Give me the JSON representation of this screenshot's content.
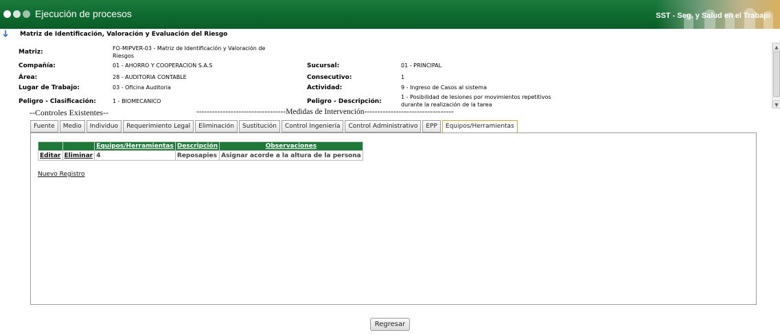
{
  "header": {
    "title": "Ejecución de procesos",
    "brand": "SST - Seg. y Salud en el Trabajo"
  },
  "section_title": "Matriz de Identificación, Valoración y Evaluación del Riesgo",
  "info": {
    "matriz_label": "Matriz:",
    "matriz_value": "FO-MIPVER-03 - Matriz de Identificación y Valoración de Riesgos",
    "compania_label": "Compañía:",
    "compania_value": "01 - AHORRO Y COOPERACION S.A.S",
    "sucursal_label": "Sucursal:",
    "sucursal_value": "01 - PRINCIPAL",
    "area_label": "Área:",
    "area_value": "28 - AUDITORIA CONTABLE",
    "consecutivo_label": "Consecutivo:",
    "consecutivo_value": "1",
    "lugar_label": "Lugar de Trabajo:",
    "lugar_value": "03 - Oficina Auditoria",
    "actividad_label": "Actividad:",
    "actividad_value": "9 - Ingreso de Casos al sistema",
    "peligro_clas_label": "Peligro - Clasificación:",
    "peligro_clas_value": "1 - BIOMECANICO",
    "peligro_desc_label": "Peligro - Descripción:",
    "peligro_desc_value": "1 - Posibilidad de lesiones por movimientos repetitivos durante la realización de la tarea"
  },
  "headings": {
    "controles": "--Controles Existentes--",
    "medidas": "----------------------------------Medidas de Intervención----------------------------------"
  },
  "tabs": [
    {
      "label": "Fuente"
    },
    {
      "label": "Medio"
    },
    {
      "label": "Individuo"
    },
    {
      "label": "Requerimiento Legal"
    },
    {
      "label": "Eliminación"
    },
    {
      "label": "Sustitución"
    },
    {
      "label": "Control Ingeniería"
    },
    {
      "label": "Control Administrativo"
    },
    {
      "label": "EPP"
    },
    {
      "label": "Equipos/Herramientas"
    }
  ],
  "active_tab": "Equipos/Herramientas",
  "grid": {
    "columns": [
      "",
      "",
      "Equipos/Herramientas",
      "Descripción",
      "Observaciones"
    ],
    "rows": [
      {
        "edit": "Editar",
        "delete": "Eliminar",
        "equipos": "4",
        "descripcion": "Reposapies",
        "observaciones": "Asignar acorde a la altura de la persona"
      }
    ]
  },
  "new_record_label": "Nuevo Registro",
  "back_button_label": "Regresar",
  "colors": {
    "header_green": "#0f6a2f",
    "grid_header_green": "#1f7a3a",
    "active_tab_border": "#d8a23a"
  }
}
